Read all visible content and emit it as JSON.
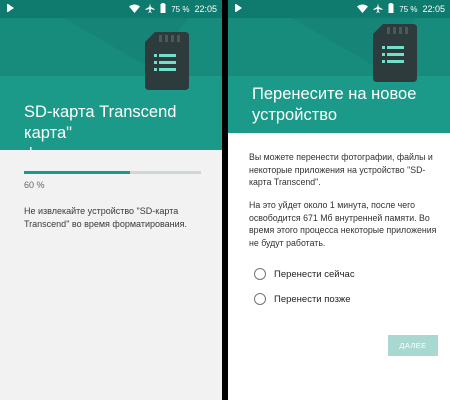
{
  "colors": {
    "accent": "#1b9a89",
    "status_bar": "#0e7b6e",
    "button_disabled": "#a8d8d0"
  },
  "left": {
    "status": {
      "battery": "75 %",
      "time": "22:05"
    },
    "title": "SD-карта Transcend      карта\"\nформатируется…",
    "progress": {
      "fraction": 0.6,
      "label": "60 %"
    },
    "warning": "Не извлекайте устройство \"SD-карта Transcend\" во время форматирования."
  },
  "right": {
    "status": {
      "battery": "75 %",
      "time": "22:05"
    },
    "title": "Перенесите на новое\nустройство",
    "paragraph1": "Вы можете перенести фотографии, файлы и некоторые приложения на устройство \"SD-карта Transcend\".",
    "paragraph2": "На это уйдет около 1 минута, после чего освободится 671 Мб внутренней памяти. Во время этого процесса некоторые приложения не будут работать.",
    "options": [
      {
        "label": "Перенести сейчас"
      },
      {
        "label": "Перенести позже"
      }
    ],
    "next_label": "ДАЛЕЕ"
  }
}
